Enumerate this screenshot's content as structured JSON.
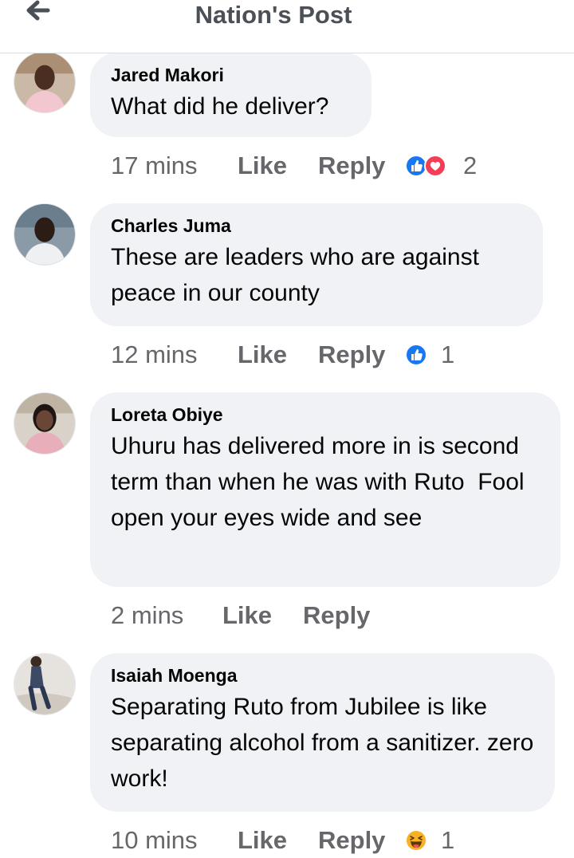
{
  "header": {
    "title": "Nation's Post",
    "back_icon": "arrow-left-icon"
  },
  "colors": {
    "bubble": "#f0f2f5",
    "meta_text": "#65676b",
    "like_blue": "#1877f2",
    "love_red": "#f33e58",
    "haha_yellow": "#f7b125"
  },
  "comments": [
    {
      "author": "Jared Makori",
      "text": "What did he deliver?",
      "time": "17 mins",
      "like": "Like",
      "reply": "Reply",
      "reactions": [
        "like",
        "love"
      ],
      "reaction_count": "2"
    },
    {
      "author": "Charles Juma",
      "text": "These are leaders who are against peace in our county",
      "time": "12 mins",
      "like": "Like",
      "reply": "Reply",
      "reactions": [
        "like"
      ],
      "reaction_count": "1"
    },
    {
      "author": "Loreta Obiye",
      "text": "Uhuru has delivered more in is second term than when he was with Ruto  Fool open your eyes wide and see",
      "time": "2 mins",
      "like": "Like",
      "reply": "Reply",
      "reactions": [],
      "reaction_count": ""
    },
    {
      "author": "Isaiah Moenga",
      "text": "Separating Ruto from Jubilee is like separating alcohol from a sanitizer. zero work!",
      "time": "10 mins",
      "like": "Like",
      "reply": "Reply",
      "reactions": [
        "haha"
      ],
      "reaction_count": "1"
    }
  ]
}
